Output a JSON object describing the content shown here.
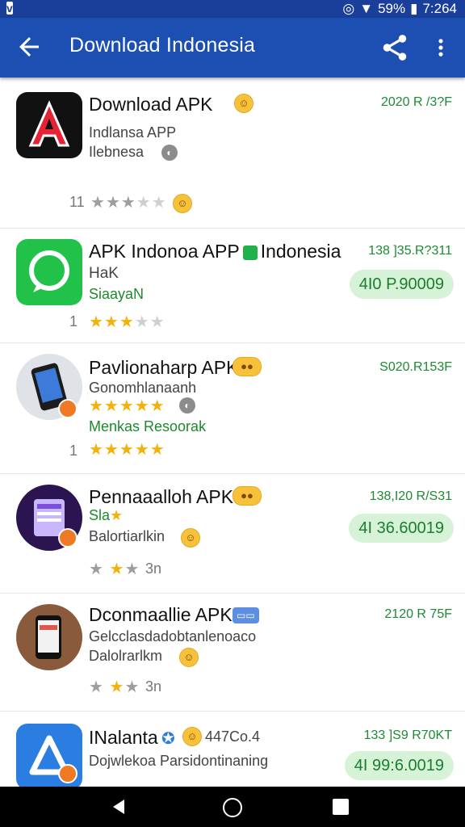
{
  "status_bar": {
    "battery_text": "59%",
    "time": "7:264"
  },
  "appbar": {
    "title": "Download Indonesia"
  },
  "colors": {
    "appbar": "#1d4fb3",
    "accent_green": "#1d8a33",
    "star": "#f2b20c"
  },
  "icons": [
    "back-arrow-icon",
    "share-icon",
    "more-vert-icon",
    "home-circle-icon"
  ],
  "rows": [
    {
      "name": "Download APK",
      "sub1": "Indlansa APP",
      "sub2": "Ilebnesa",
      "date": "2020 R /3?F",
      "count": "11",
      "rating": 3
    },
    {
      "name": "APK Indonoa APP",
      "name_tail": "Indonesia",
      "sub1": "HaK",
      "sub2": "SiaayaN",
      "date": "138 ]35.R?311",
      "pill": "4I0 P.90009",
      "count": "1",
      "rating": 3
    },
    {
      "name": "Pavlionaharp APK",
      "sub1": "Gonomhlanaanh",
      "sub2": "Menkas Resoorak",
      "date": "S020.R153F",
      "count": "1",
      "rating": 5
    },
    {
      "name": "Pennaaalloh APK",
      "sub1": "Sla",
      "sub2": "Balortiarlkin",
      "date": "138,I20 R/S31",
      "pill": "4I 36.60019",
      "tail": "3n",
      "rating": 2
    },
    {
      "name": "Dconmaallie APK",
      "sub1": "Gelcclasdadobtanlenoaco",
      "sub2": "Dalolrarlkm",
      "date": "2120 R 75F",
      "tail": "3n",
      "rating": 2
    },
    {
      "name": "INalanta",
      "name_tail": "447Co.4",
      "sub1": "Dojwlekoa Parsidontinaning",
      "date": "133 ]S9 R70KT",
      "pill": "4I 99:6.0019"
    }
  ]
}
